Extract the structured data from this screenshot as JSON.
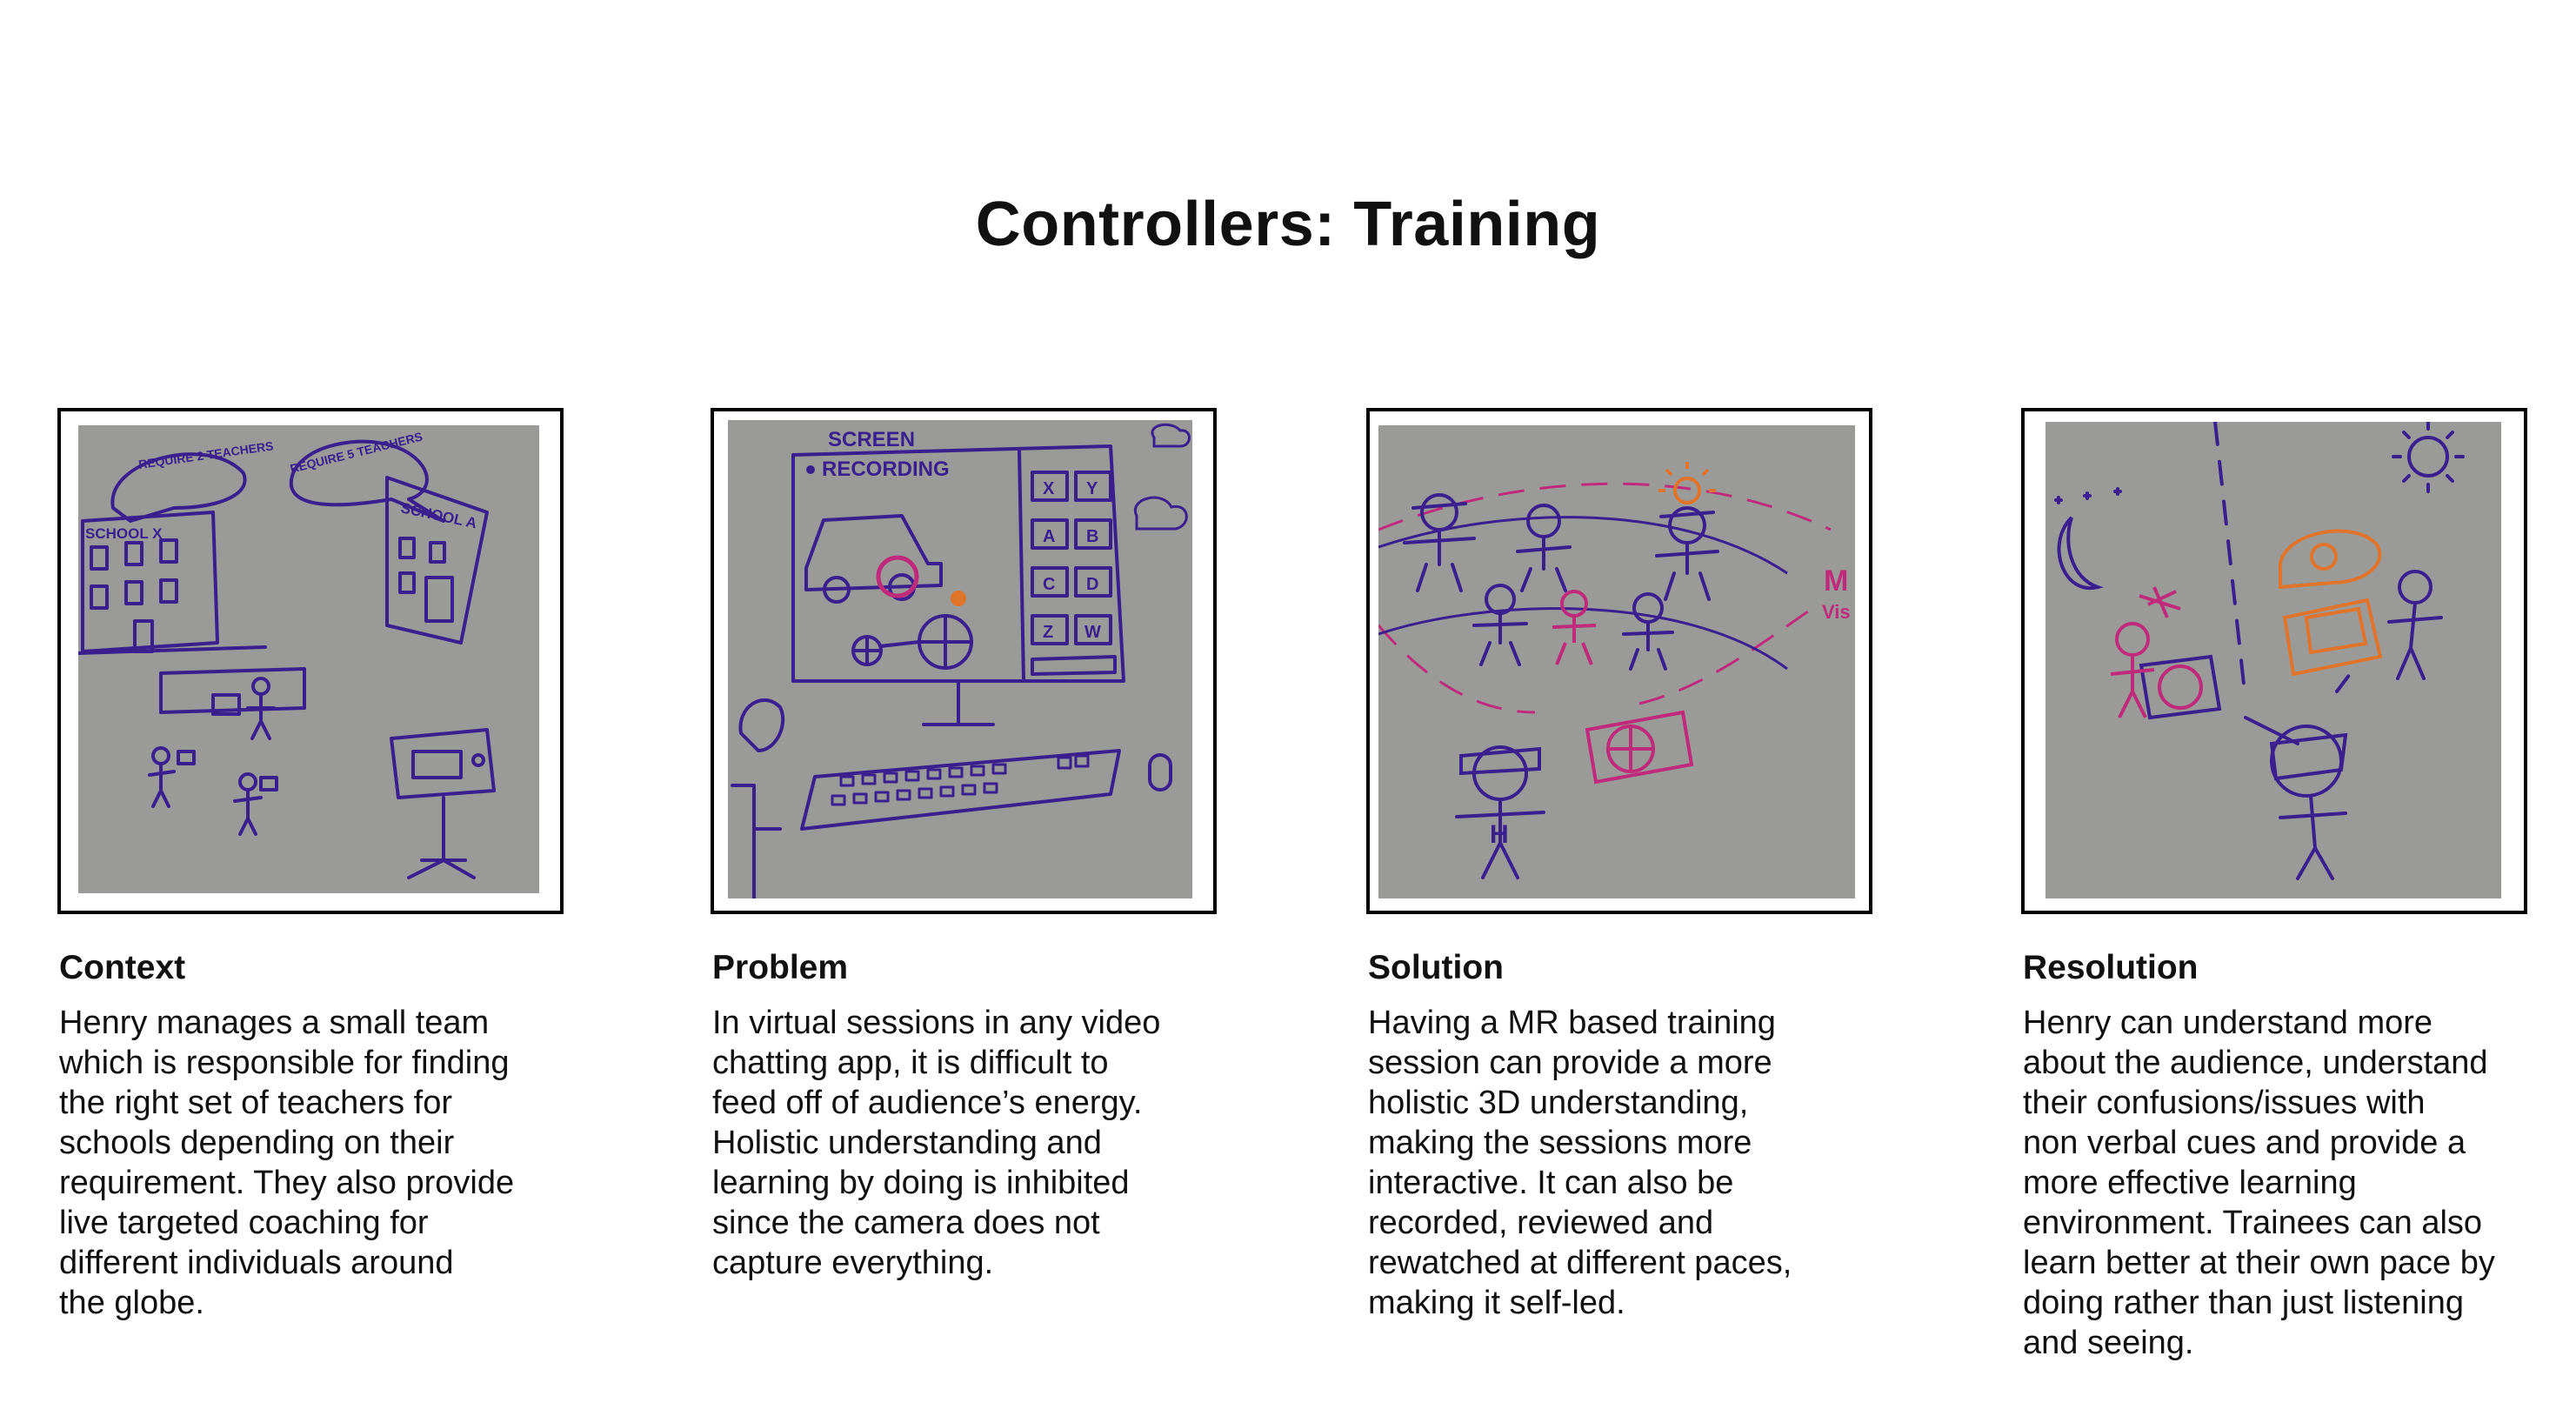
{
  "page": {
    "title": "Controllers: Training"
  },
  "panels": [
    {
      "id": "context",
      "heading": "Context",
      "body": "Henry manages a small team\nwhich is responsible for finding\nthe right set of teachers for\nschools depending on their\nrequirement. They also provide\nlive targeted coaching for\ndifferent individuals around\nthe globe.",
      "sketch_labels": [
        "REQUIRE 2 TEACHERS",
        "REQUIRE 5 TEACHERS",
        "SCHOOL X",
        "SCHOOL A"
      ]
    },
    {
      "id": "problem",
      "heading": "Problem",
      "body": "In virtual sessions in any video\nchatting app, it is difficult to\nfeed off of audience’s energy.\nHolistic understanding and\nlearning by doing is inhibited\nsince the camera does not\ncapture everything.",
      "sketch_labels": [
        "SCREEN",
        "RECORDING",
        "X",
        "Y",
        "A",
        "B",
        "C",
        "D",
        "Z",
        "W"
      ]
    },
    {
      "id": "solution",
      "heading": "Solution",
      "body": "Having a MR based training\nsession can provide a more\nholistic 3D understanding,\nmaking the sessions more\ninteractive. It can also be\nrecorded, reviewed and\nrewatched at different paces,\nmaking it self-led.",
      "sketch_labels": [
        "H",
        "M",
        "Vis"
      ]
    },
    {
      "id": "resolution",
      "heading": "Resolution",
      "body": "Henry can understand more\nabout the audience, understand\ntheir confusions/issues with\nnon verbal cues and provide a\nmore effective learning\nenvironment. Trainees can also\nlearn better at their own pace by\ndoing rather than just listening\nand seeing.",
      "sketch_labels": []
    }
  ],
  "colors": {
    "ink_purple": "#3a1f8f",
    "ink_magenta": "#c02a7a",
    "ink_orange": "#e0742a",
    "paper_gray": "#9a9b99"
  }
}
